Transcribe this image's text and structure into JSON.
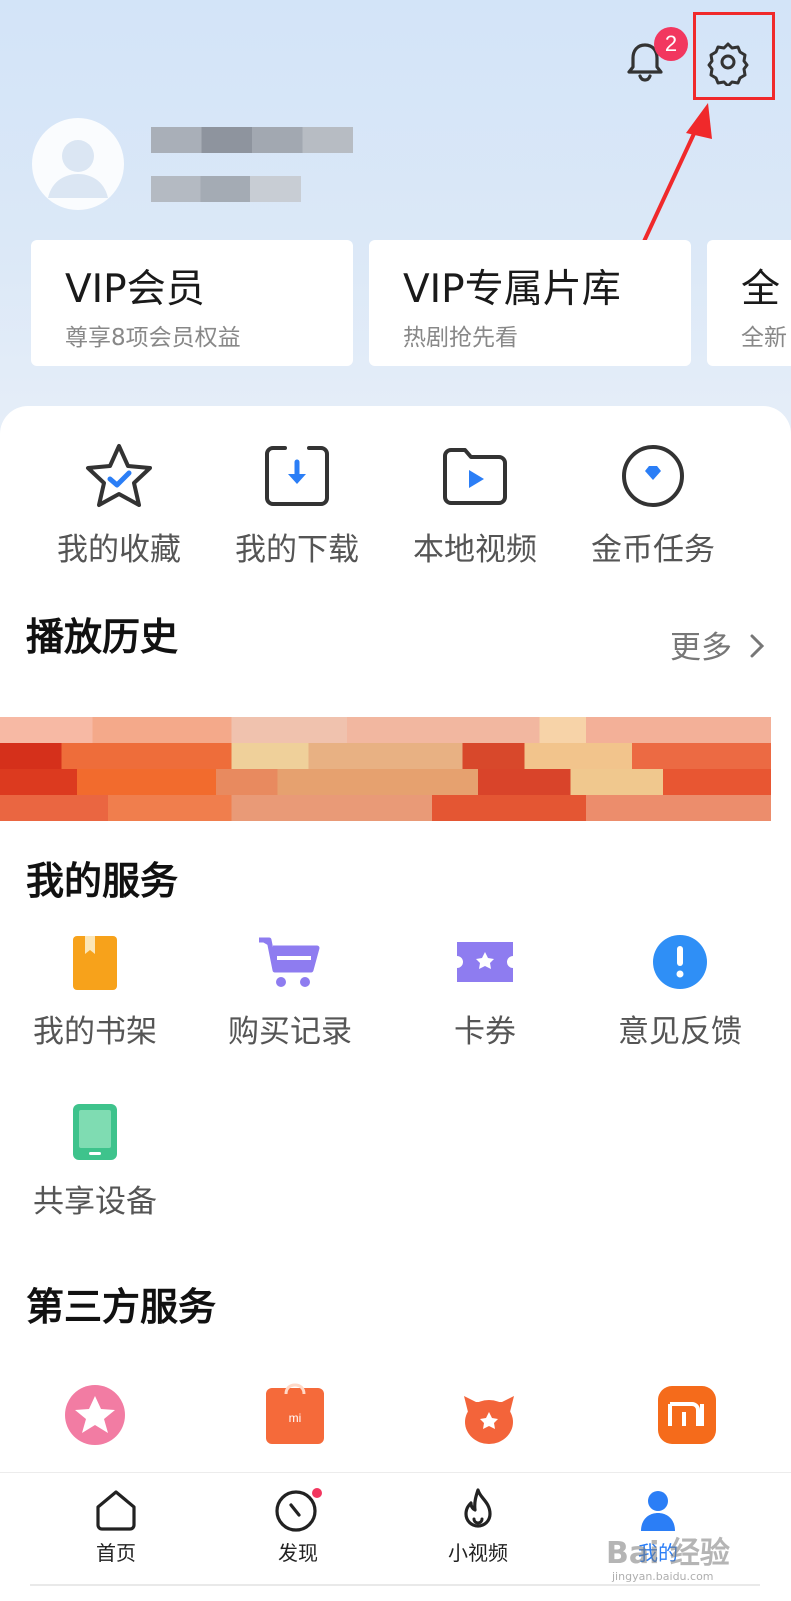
{
  "notifications": {
    "badge_count": "2"
  },
  "vip_cards": [
    {
      "title": "VIP会员",
      "subtitle": "尊享8项会员权益"
    },
    {
      "title": "VIP专属片库",
      "subtitle": "热剧抢先看"
    },
    {
      "title": "全",
      "subtitle": "全新"
    }
  ],
  "quick_actions": [
    {
      "label": "我的收藏",
      "icon": "star-icon"
    },
    {
      "label": "我的下载",
      "icon": "download-icon"
    },
    {
      "label": "本地视频",
      "icon": "folder-video-icon"
    },
    {
      "label": "金币任务",
      "icon": "coin-icon"
    }
  ],
  "history": {
    "title": "播放历史",
    "more_label": "更多"
  },
  "my_services": {
    "title": "我的服务",
    "items": [
      {
        "label": "我的书架",
        "icon": "bookshelf-icon",
        "color": "#f7a21b"
      },
      {
        "label": "购买记录",
        "icon": "cart-icon",
        "color": "#8e7cf0"
      },
      {
        "label": "卡券",
        "icon": "ticket-icon",
        "color": "#8e7cf0"
      },
      {
        "label": "意见反馈",
        "icon": "feedback-icon",
        "color": "#2f8ff6"
      },
      {
        "label": "共享设备",
        "icon": "tablet-icon",
        "color": "#3ec38c"
      }
    ]
  },
  "third_party": {
    "title": "第三方服务"
  },
  "bottom_nav": [
    {
      "label": "首页",
      "icon": "home-icon"
    },
    {
      "label": "发现",
      "icon": "compass-icon"
    },
    {
      "label": "小视频",
      "icon": "flame-icon"
    },
    {
      "label": "我的",
      "icon": "user-icon",
      "active": true
    }
  ],
  "watermark": {
    "brand": "Bai 经验",
    "url": "jingyan.baidu.com"
  },
  "colors": {
    "accent": "#2b7ef6",
    "badge": "#f2375f",
    "highlight": "#f0292b"
  }
}
